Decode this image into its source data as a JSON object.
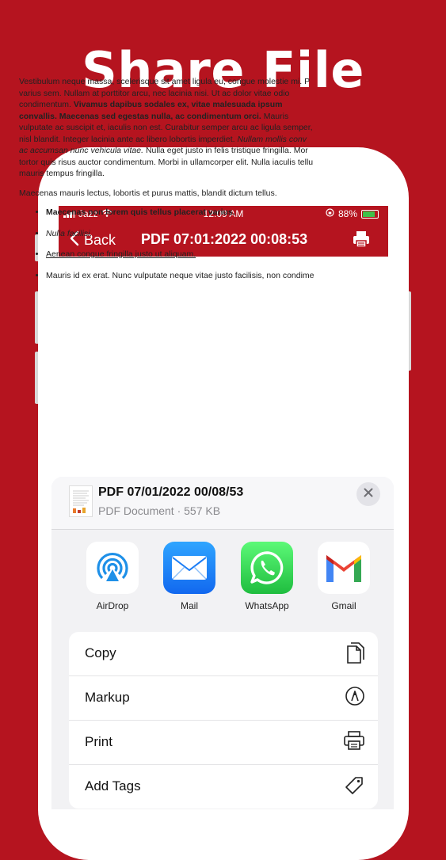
{
  "headline": "Share File",
  "status_bar": {
    "carrier": "Jazz",
    "time": "12:09 AM",
    "battery": "88%"
  },
  "nav": {
    "back_label": "Back",
    "title": "PDF 07:01:2022 00:08:53",
    "print_icon": "printer-icon"
  },
  "document": {
    "paragraph1_lines": [
      "Vestibulum neque massa, scelerisque sit amet ligula eu, congue molestie mi. P",
      "varius sem. Nullam at porttitor arcu, nec lacinia nisi. Ut ac dolor vitae odio",
      "condimentum.",
      "Vivamus dapibus sodales ex, vitae malesuada ipsum",
      "convallis. Maecenas sed egestas nulla, ac condimentum orci.",
      "Mauris",
      "vulputate ac suscipit et, iaculis non est. Curabitur semper arcu ac ligula semper,",
      "nisl blandit. Integer lacinia ante ac libero lobortis imperdiet.",
      "Nullam mollis conv",
      "ac accumsan nunc vehicula vitae.",
      "Nulla eget justo in felis tristique fringilla. Mor",
      "tortor quis risus auctor condimentum. Morbi in ullamcorper elit. Nulla iaculis tellu",
      "mauris tempus fringilla."
    ],
    "paragraph2": "Maecenas mauris lectus, lobortis et purus mattis, blandit dictum tellus.",
    "bullets": [
      "Maecenas non lorem quis tellus placerat varius.",
      "Nulla facilisi.",
      "Aenean congue fringilla justo ut aliquam.",
      "Mauris id ex erat. Nunc vulputate neque vitae justo facilisis, non condime"
    ]
  },
  "share_sheet": {
    "file_name": "PDF 07/01/2022 00/08/53",
    "file_meta": "PDF Document · 557 KB",
    "apps": [
      {
        "label": "AirDrop",
        "icon": "airdrop-icon"
      },
      {
        "label": "Mail",
        "icon": "mail-icon"
      },
      {
        "label": "WhatsApp",
        "icon": "whatsapp-icon"
      },
      {
        "label": "Gmail",
        "icon": "gmail-icon"
      }
    ],
    "actions": [
      {
        "label": "Copy",
        "icon": "copy-icon"
      },
      {
        "label": "Markup",
        "icon": "markup-icon"
      },
      {
        "label": "Print",
        "icon": "printer-icon"
      },
      {
        "label": "Add Tags",
        "icon": "tag-icon"
      }
    ]
  },
  "colors": {
    "brand_red": "#b5141f",
    "whatsapp_green": "#25d366",
    "mail_blue": "#1a8cff",
    "airdrop_blue": "#1e90e8"
  }
}
